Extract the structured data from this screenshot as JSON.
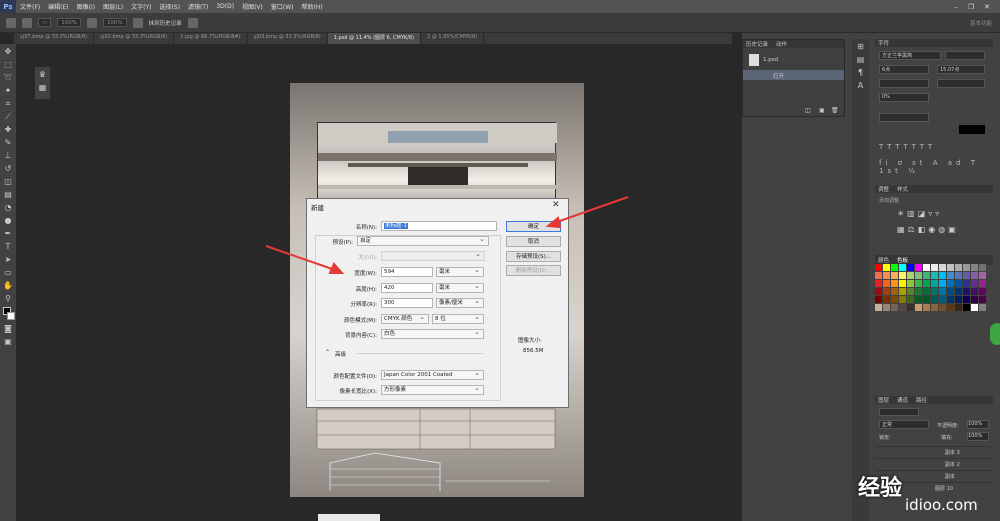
{
  "app": {
    "logo": "Ps"
  },
  "menubar": {
    "items": [
      "文件(F)",
      "编辑(E)",
      "图像(I)",
      "图层(L)",
      "文字(Y)",
      "选择(S)",
      "滤镜(T)",
      "3D(D)",
      "视图(V)",
      "窗口(W)",
      "帮助(H)"
    ]
  },
  "optbar": {
    "mode_value": "100%",
    "flow_value": "100%",
    "history_label": "抹到历史记录",
    "workspace": "基本功能"
  },
  "tabs": [
    {
      "label": "yj07.bmp @ 33.3%(RGB/8)",
      "active": false
    },
    {
      "label": "yj02.bmp @ 33.3%(RGB/8)",
      "active": false
    },
    {
      "label": "1.jpg @ 66.7%(RGB/8#)",
      "active": false
    },
    {
      "label": "yj03.bmp @ 33.3%(RGB/8)",
      "active": false
    },
    {
      "label": "1.psd @ 11.4% (图层 6, CMYK/8)",
      "active": true
    },
    {
      "label": "2 @ 1.95%(CMYK/8)",
      "active": false
    }
  ],
  "history_panel": {
    "tabs": [
      "历史记录",
      "动作"
    ],
    "doc_name": "1.psd",
    "step": "打开"
  },
  "char_panel": {
    "tab": "字符",
    "font": "方正兰亭黑简",
    "size": "6点",
    "leading": "15.07点",
    "tracking": "0%"
  },
  "adjust_panel": {
    "tabs": [
      "调整",
      "样式"
    ],
    "hint": "添加调整"
  },
  "color_panel": {
    "tabs": [
      "颜色",
      "色板"
    ]
  },
  "layers_panel": {
    "tabs": [
      "图层",
      "通道",
      "路径"
    ],
    "blend": "正常",
    "opacity_label": "不透明度:",
    "opacity": "100%",
    "lock_label": "锁定:",
    "fill_label": "填充:",
    "fill": "100%",
    "rows": [
      "副本 3",
      "副本 2",
      "副本",
      "图层 10"
    ]
  },
  "dialog": {
    "title": "新建",
    "name_label": "名称(N):",
    "name_value": "未标题-1",
    "preset_label": "预设(P):",
    "preset_value": "自定",
    "size_label": "大小(I):",
    "width_label": "宽度(W):",
    "width_value": "594",
    "width_unit": "毫米",
    "height_label": "高度(H):",
    "height_value": "420",
    "height_unit": "毫米",
    "res_label": "分辨率(R):",
    "res_value": "300",
    "res_unit": "像素/厘米",
    "mode_label": "颜色模式(M):",
    "mode_value": "CMYK 颜色",
    "bits_value": "8 位",
    "bg_label": "背景内容(C):",
    "bg_value": "白色",
    "advanced_label": "高级",
    "profile_label": "颜色配置文件(O):",
    "profile_value": "Japan Color 2001 Coated",
    "aspect_label": "像素长宽比(X):",
    "aspect_value": "方形像素",
    "ok_label": "确定",
    "cancel_label": "取消",
    "save_preset_label": "存储预设(S)...",
    "delete_preset_label": "删除预设(D)...",
    "image_size_label": "图像大小:",
    "image_size_value": "856.5M"
  },
  "watermark": {
    "text": "经验",
    "sub": "idioo.com"
  },
  "colors": {
    "arrow": "#e53935",
    "menubar": "#535353",
    "panel": "#424242",
    "canvas": "#282828",
    "dialog": "#f0f0f0",
    "ok_border": "#3b7ad9"
  }
}
